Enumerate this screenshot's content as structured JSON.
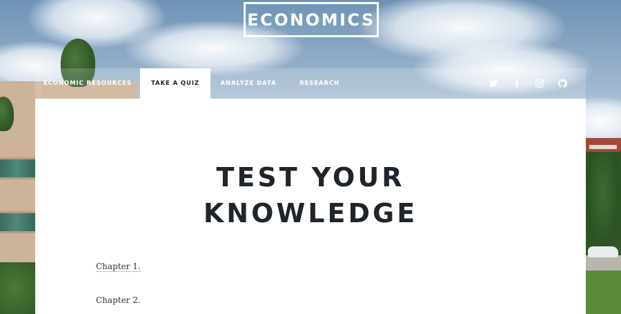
{
  "site": {
    "title": "ECONOMICS"
  },
  "nav": {
    "items": [
      {
        "label": "ECONOMIC RESOURCES",
        "active": false
      },
      {
        "label": "TAKE A QUIZ",
        "active": true
      },
      {
        "label": "ANALYZE DATA",
        "active": false
      },
      {
        "label": "RESEARCH",
        "active": false
      }
    ],
    "social": [
      "twitter-icon",
      "facebook-icon",
      "instagram-icon",
      "github-icon"
    ]
  },
  "main": {
    "title_line1": "TEST YOUR",
    "title_line2": "KNOWLEDGE",
    "chapters": [
      {
        "label": "Chapter 1."
      },
      {
        "label": "Chapter 2."
      }
    ]
  },
  "colors": {
    "title_text": "#1f252b",
    "nav_text": "#ffffff",
    "active_tab_bg": "#ffffff"
  }
}
